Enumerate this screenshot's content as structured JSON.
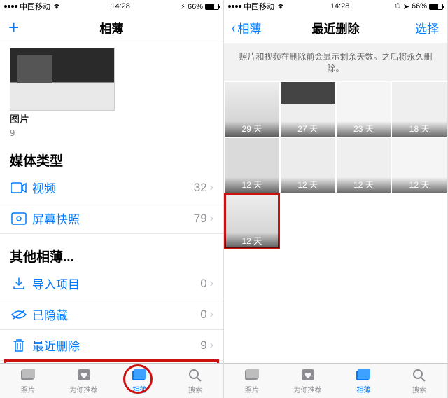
{
  "status": {
    "carrier": "中国移动",
    "time": "14:28",
    "battery": "66%"
  },
  "left": {
    "nav_title": "相薄",
    "album": {
      "name": "图片",
      "count": "9"
    },
    "section_media": "媒体类型",
    "rows_media": [
      {
        "label": "视频",
        "count": "32"
      },
      {
        "label": "屏幕快照",
        "count": "79"
      }
    ],
    "section_other": "其他相薄...",
    "rows_other": [
      {
        "label": "导入项目",
        "count": "0"
      },
      {
        "label": "已隐藏",
        "count": "0"
      },
      {
        "label": "最近删除",
        "count": "9"
      }
    ],
    "tabs": [
      "照片",
      "为你推荐",
      "相薄",
      "搜索"
    ]
  },
  "right": {
    "back": "相薄",
    "nav_title": "最近删除",
    "select": "选择",
    "banner": "照片和视频在删除前会显示剩余天数。之后将永久删除。",
    "cells": [
      {
        "days": "29 天"
      },
      {
        "days": "27 天"
      },
      {
        "days": "23 天"
      },
      {
        "days": "18 天"
      },
      {
        "days": "12 天"
      },
      {
        "days": "12 天"
      },
      {
        "days": "12 天"
      },
      {
        "days": "12 天"
      },
      {
        "days": "12 天",
        "selected": true
      }
    ],
    "tabs": [
      "照片",
      "为你推荐",
      "相薄",
      "搜索"
    ]
  }
}
